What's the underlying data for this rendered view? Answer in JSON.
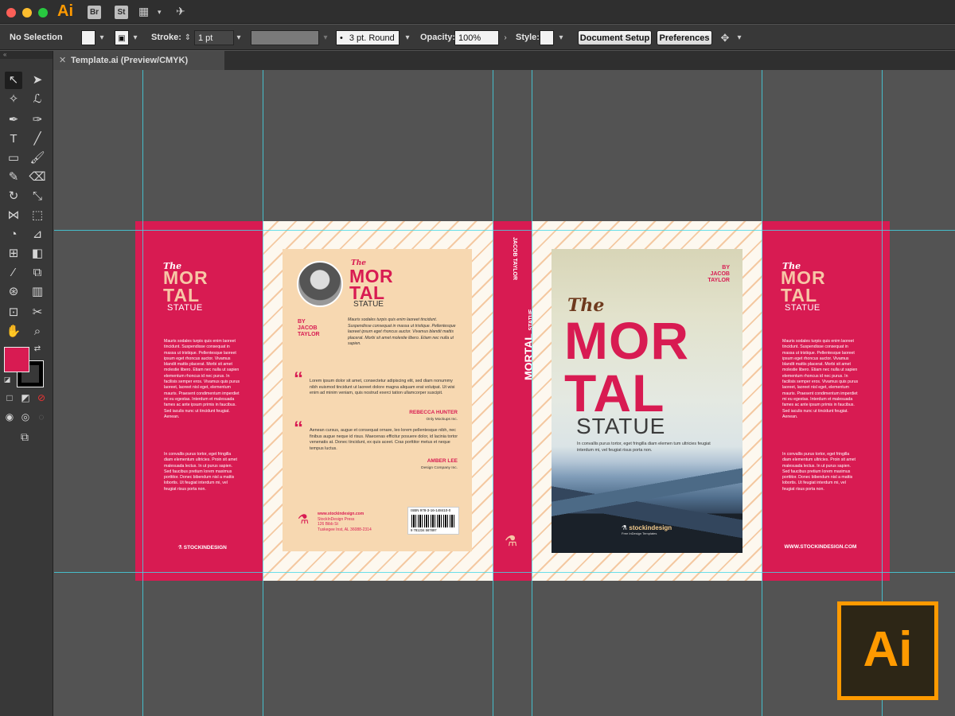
{
  "app": {
    "logo_text": "Ai",
    "br_label": "Br",
    "st_label": "St"
  },
  "controlbar": {
    "selection": "No Selection",
    "stroke_label": "Stroke:",
    "stroke_value": "1 pt",
    "brush_value": "3 pt. Round",
    "opacity_label": "Opacity:",
    "opacity_value": "100%",
    "style_label": "Style:",
    "document_setup": "Document Setup",
    "preferences": "Preferences",
    "brush_dot": "•"
  },
  "tab": {
    "title": "Template.ai (Preview/CMYK)",
    "close": "✕"
  },
  "colors": {
    "accent": "#d81b52",
    "peach": "#f7d8b1",
    "illustrator_orange": "#ff9a00"
  },
  "artwork": {
    "the": "The",
    "mor": "MOR",
    "tal": "TAL",
    "statue": "STATUE",
    "author_by": "BY",
    "author_first": "JACOB",
    "author_last": "TAYLOR",
    "spine_author": "JACOB TAYLOR",
    "flap_para1": "Mauris sodales turpis quis enim laoreet tincidunt. Suspendisse consequat in massa ut tristique. Pellentesque laoreet ipsum eget rhoncus auctor. Vivamus blandit mattis placerat. Morbi sit amet molestie libero. Etiam nec nulla ut sapien elementum rhoncus id nec purus. In facilisis semper eros. Vivamus quis purus laoreet, laoreet nisl eget, elementum mauris. Praesent condimentum imperdiet mi eu egestas. Interdum et malesuada fames ac ante ipsum primis in faucibus. Sed iaculis nunc ut tincidunt feugiat. Aenean.",
    "flap_para2": "In convallis purus tortor, eget fringilla diam elementum ultricies. Proin sit amet malesuada lectus. In ut purus sapien. Sed faucibus pretium lorem maximus porttitor. Donec bibendum nisl a mattis lobortis. Ut feugiat interdum mi, vel feugiat risus porta non.",
    "flap_left_footer": "STOCKINDESIGN",
    "flap_right_footer": "WWW.STOCKINDESIGN.COM",
    "back_intro": "Mauris sodales turpis quis enim laoreet tincidunt. Suspendisse consequat in massa ut tristique. Pellentesque laoreet ipsum eget rhoncus auctor. Vivamus blandit mattis placerat. Morbi sit amet molestie libero. Etiam nec nulla ut sapien.",
    "quote1": "Lorem ipsum dolor sit amet, consectetur adipiscing elit, sed diam nonummy nibh euismod tincidunt ut laoreet dolore magna aliquam erat volutpat. Ut wisi enim ad minim veniam, quis nostrud exerci tation ullamcorper suscipit.",
    "quote1_name": "REBECCA HUNTER",
    "quote1_company": "Only Mockups Inc.",
    "quote2": "Aenean cursus, augue et consequat ornare, leo lorem pellentesque nibh, nec finibus augue neque id risus. Maecenas efficitur posuere dolor, id lacinia tortor venenatis at. Donec tincidunt, ex quis aceet. Cras porttitor metus et neque tempus luctus.",
    "quote2_name": "AMBER LEE",
    "quote2_company": "Design Company Inc.",
    "publisher_url": "www.stockindesign.com",
    "publisher_name": "StockInDesign Press",
    "publisher_street": "126 Bibb St",
    "publisher_city": "Tuskegee Inst, AL 36088-2314",
    "isbn": "ISBN 978-3-16-148410-0",
    "barcode_digits": "9 781234 567897",
    "front_blurb": "In convallis purus tortor, eget fringilla diam elemen tum ultricies feugiat interdum mi, vel feugiat risus porta non.",
    "front_logo": "stockindesign",
    "front_logo_tagline": "Free InDesign Templates",
    "quote_mark": "“",
    "flask": "⚗"
  },
  "corner_logo": "Ai"
}
